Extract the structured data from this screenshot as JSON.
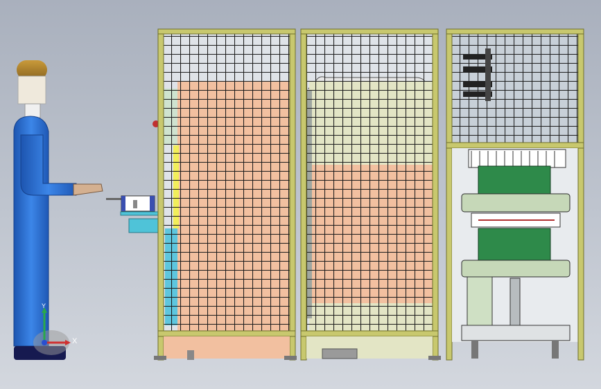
{
  "viewport": {
    "background_top": "#a9b0bd",
    "background_bottom": "#d3d7de"
  },
  "colors": {
    "frame": "#c8c86e",
    "frame_dark": "#6e6e2a",
    "mesh": "#1c1c1c",
    "panel_salmon": "#f2c0a0",
    "panel_cream": "#e3e5c5",
    "cabinet_top": "#c8d0d8",
    "machine_green": "#2e8a4a",
    "plate_green": "#c6d8b8",
    "operator_suit": "#2a6fd0",
    "operator_helmet": "#b98a2e",
    "tray_cyan": "#4fc3d8",
    "tray_blue": "#3a4fb0"
  },
  "triad": {
    "x_label": "X",
    "y_label": "Y"
  }
}
